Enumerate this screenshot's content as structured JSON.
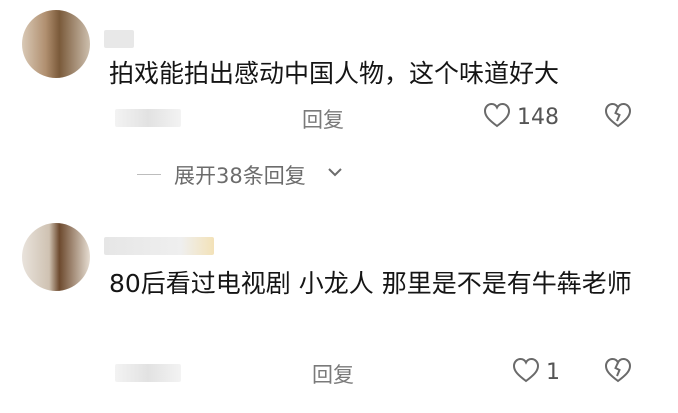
{
  "comments": [
    {
      "text": "拍戏能拍出感动中国人物，这个味道好大",
      "reply_label": "回复",
      "like_count": "148",
      "expand_label": "展开38条回复"
    },
    {
      "text": "80后看过电视剧 小龙人 那里是不是有牛犇老师",
      "reply_label": "回复",
      "like_count": "1"
    }
  ],
  "icons": {
    "like": "heart-outline-icon",
    "dislike": "broken-heart-icon",
    "expand": "chevron-down-icon"
  },
  "colors": {
    "text": "#151515",
    "meta": "#7a7a7a",
    "icon": "#6a6a6a"
  }
}
